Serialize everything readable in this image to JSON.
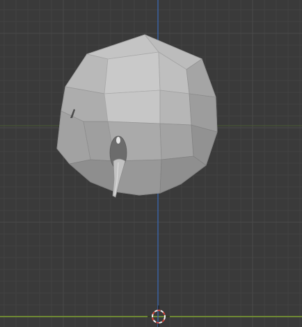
{
  "colors": {
    "viewport_bg": "#3a3a3a",
    "grid_minor": "#424242",
    "grid_major": "#4a4a4a",
    "axis_x": "#7a9a3a",
    "axis_y": "#3a64a8",
    "horizon": "#6f8a34",
    "cursor_red": "#d8463a",
    "cursor_white": "#f2f2f2",
    "mesh_light": "#c9c9c9",
    "mesh_mid": "#acacac",
    "mesh_dark": "#8c8c8c",
    "mesh_edge": "#9a9a9a"
  },
  "icons": {
    "object": "mesh-object",
    "cursor": "3d-cursor-icon"
  }
}
